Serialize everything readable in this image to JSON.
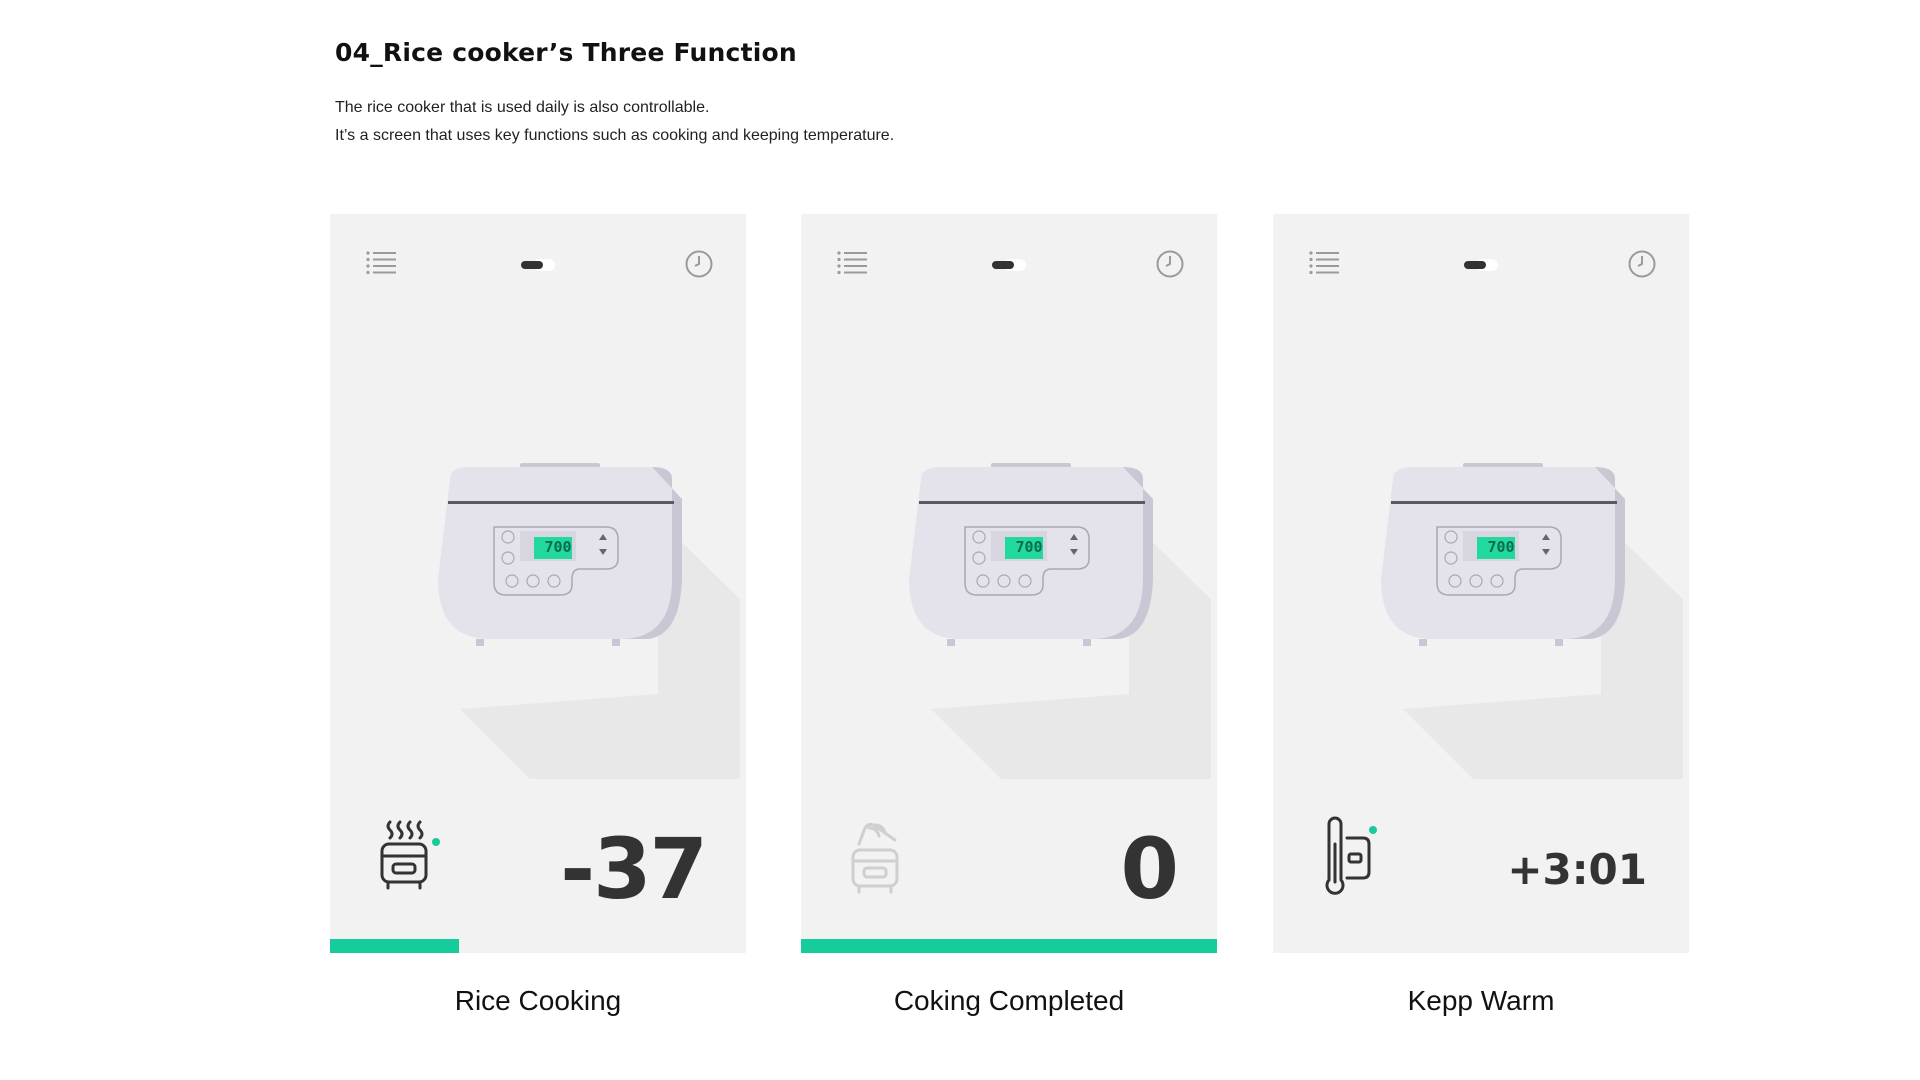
{
  "header": {
    "title": "04_Rice cooker’s Three Function",
    "desc_line1": "The rice cooker that is used daily is also controllable.",
    "desc_line2": "It’s a screen that uses key functions such as cooking and keeping temperature."
  },
  "accent_color": "#16cc9b",
  "panels": [
    {
      "caption": "Rice Cooking",
      "value": "-37",
      "display": "700",
      "status_icon": "steaming-cooker-icon",
      "progress": 0.31
    },
    {
      "caption": "Coking Completed",
      "value": "0",
      "display": "700",
      "status_icon": "cooker-done-icon",
      "progress": 1.0
    },
    {
      "caption": "Kepp Warm",
      "value": "+3:01",
      "display": "700",
      "status_icon": "thermometer-icon",
      "progress": 0
    }
  ]
}
